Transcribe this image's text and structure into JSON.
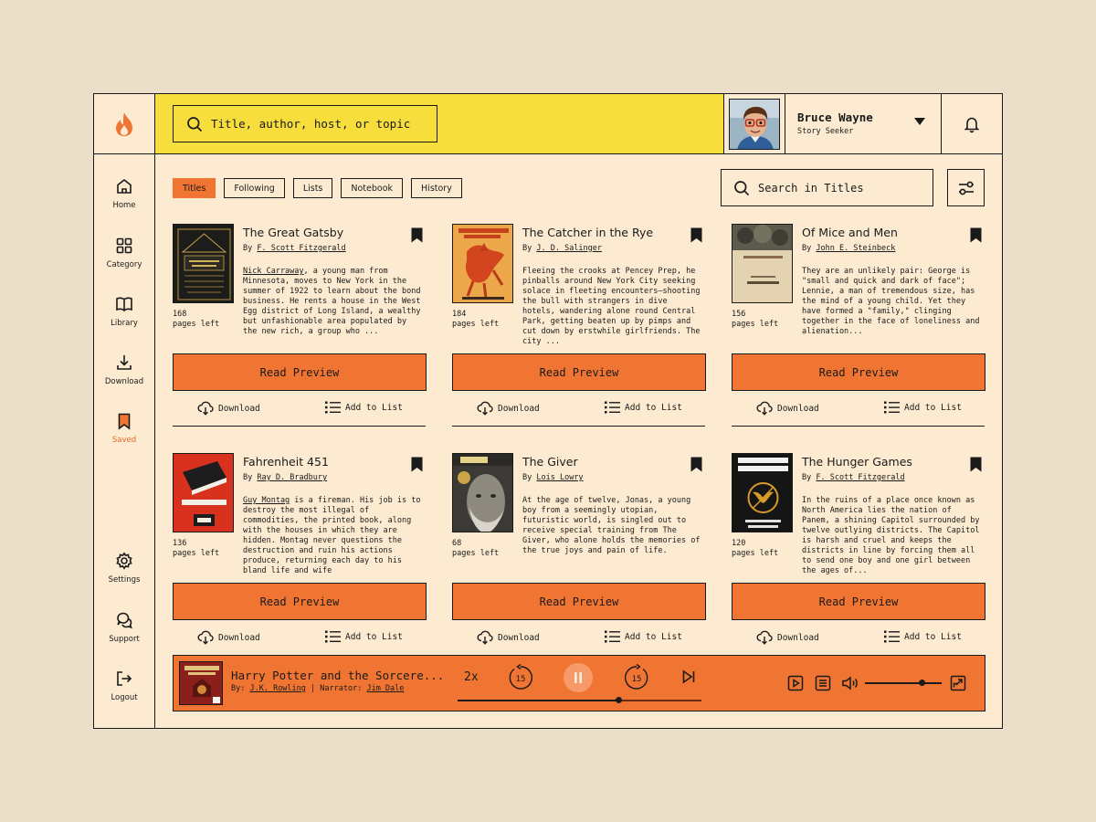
{
  "sidebar": {
    "items": [
      {
        "label": "Home",
        "icon": "home-icon"
      },
      {
        "label": "Category",
        "icon": "grid-icon"
      },
      {
        "label": "Library",
        "icon": "book-open-icon"
      },
      {
        "label": "Download",
        "icon": "download-icon"
      },
      {
        "label": "Saved",
        "icon": "bookmark-icon",
        "active": true
      },
      {
        "label": "Settings",
        "icon": "gear-icon"
      },
      {
        "label": "Support",
        "icon": "chat-icon"
      },
      {
        "label": "Logout",
        "icon": "logout-icon"
      }
    ]
  },
  "header": {
    "search_placeholder": "Title, author, host, or topic",
    "user": {
      "name": "Bruce Wayne",
      "role": "Story Seeker"
    }
  },
  "tabs": [
    "Titles",
    "Following",
    "Lists",
    "Notebook",
    "History"
  ],
  "active_tab": "Titles",
  "title_search_placeholder": "Search in Titles",
  "card_actions": {
    "preview": "Read Preview",
    "download": "Download",
    "add_to_list": "Add to List"
  },
  "by_prefix": "By",
  "pages_suffix": "pages left",
  "books": [
    {
      "title": "The Great Gatsby",
      "author": "F. Scott Fitzgerald",
      "pages": "168",
      "desc_link": "Nick Carraway",
      "desc": ", a young man from Minnesota, moves to New York in the summer of 1922 to learn about the bond business. He rents a house in the West Egg district of Long Island, a wealthy but unfashionable area populated by the new rich, a group who ..."
    },
    {
      "title": "The Catcher in the Rye",
      "author": "J. D. Salinger",
      "pages": "184",
      "desc_link": "",
      "desc": "Fleeing the crooks at Pencey Prep, he pinballs around New York City seeking solace in fleeting encounters—shooting the bull with strangers in dive hotels, wandering alone round Central Park, getting beaten up by pimps and cut down by erstwhile girlfriends. The city ..."
    },
    {
      "title": "Of Mice and Men",
      "author": "John E. Steinbeck",
      "pages": "156",
      "desc_link": "",
      "desc": "They are an unlikely pair: George is \"small and quick and dark of face\"; Lennie, a man of tremendous size, has the mind of a young child. Yet they have formed a \"family,\" clinging together in the face of loneliness and alienation..."
    },
    {
      "title": "Fahrenheit 451",
      "author": "Ray D. Bradbury",
      "pages": "136",
      "desc_link": "Guy Montag",
      "desc": " is a fireman. His job is to destroy the most illegal of commodities, the printed book, along with the houses in which they are hidden. Montag never questions the destruction and ruin his actions produce, returning each day to his bland life and wife"
    },
    {
      "title": "The Giver",
      "author": "Lois Lowry",
      "pages": "68",
      "desc_link": "",
      "desc": "At the age of twelve, Jonas, a young boy from a seemingly utopian, futuristic world, is singled out to receive special training from The Giver, who alone holds the memories of the true joys and pain of life."
    },
    {
      "title": "The Hunger Games",
      "author": "F. Scott Fitzgerald",
      "pages": "120",
      "desc_link": "",
      "desc": "In the ruins of a place once known as North America lies the nation of Panem, a shining Capitol surrounded by twelve outlying districts. The Capitol is harsh and cruel and keeps the districts in line by forcing them all to send one boy and one girl between the ages of..."
    }
  ],
  "player": {
    "title": "Harry Potter and the Sorcere...",
    "by_label": "By:",
    "author": "J.K. Rowling",
    "narrator_label": "| Narrator:",
    "narrator": "Jim Dale",
    "speed": "2x",
    "skip_back": "15",
    "skip_forward": "15",
    "progress_fraction": 0.66,
    "volume_fraction": 0.74
  },
  "colors": {
    "accent": "#f07532",
    "header_yellow": "#f7de3c",
    "background": "#fcebd0",
    "page": "#ecdfca"
  }
}
